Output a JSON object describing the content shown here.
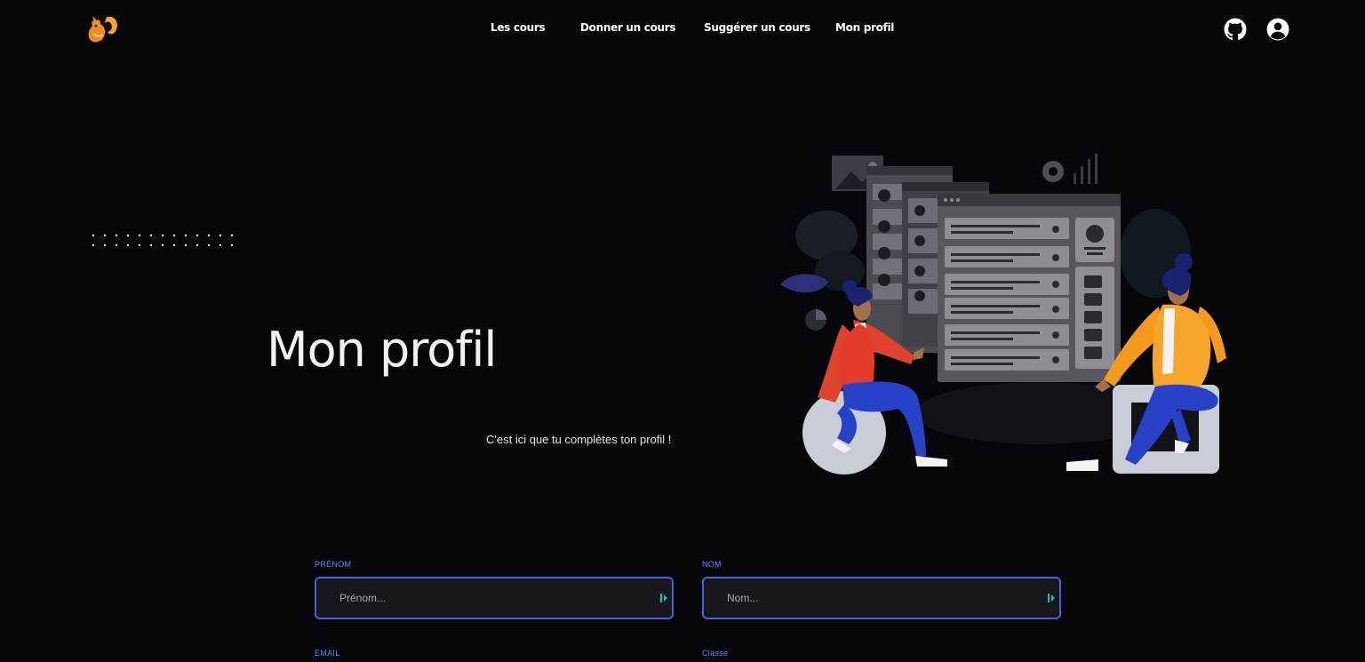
{
  "nav": {
    "items": [
      {
        "label": "Les cours"
      },
      {
        "label": "Donner un cours"
      },
      {
        "label": "Suggérer un cours"
      },
      {
        "label": "Mon profil"
      }
    ]
  },
  "header": {
    "logo_icon": "squirrel-logo-icon",
    "github_icon": "github-icon",
    "account_icon": "user-circle-icon"
  },
  "hero": {
    "title": "Mon profil",
    "subtitle": "C'est ici que tu complètes ton profil !"
  },
  "form": {
    "prenom": {
      "label": "PRÉNOM",
      "placeholder": "Prénom..."
    },
    "nom": {
      "label": "NOM",
      "placeholder": "Nom..."
    },
    "email": {
      "label": "EMAIL"
    },
    "classe": {
      "label": "Classe"
    }
  },
  "colors": {
    "background": "#05070b",
    "accent": "#6f7cf7",
    "field_border": "#4f5fd9",
    "logo_orange": "#f5a623"
  }
}
